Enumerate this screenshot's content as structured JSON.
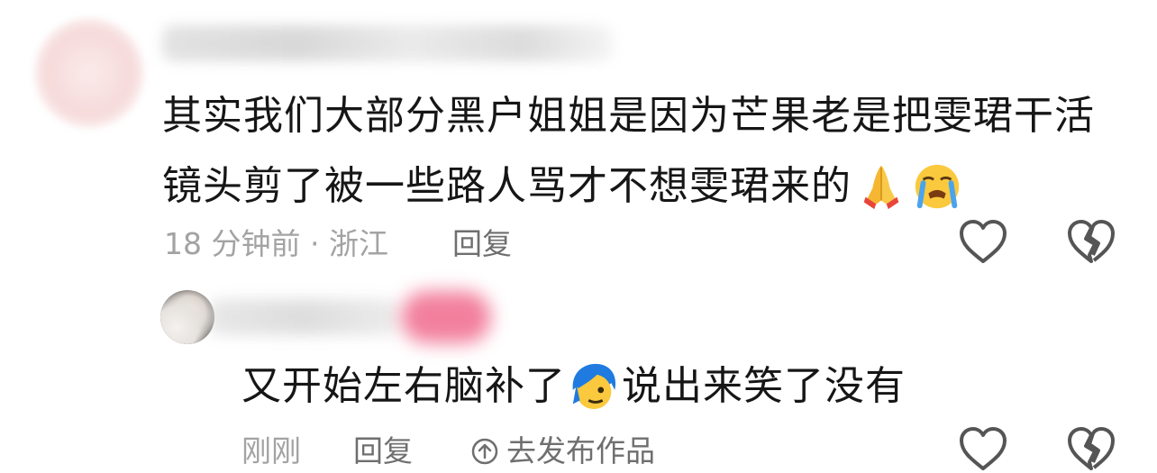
{
  "comments": [
    {
      "text_line1": "其实我们大部分黑户姐姐是因为芒果老是把雯珺干活",
      "text_line2": "镜头剪了被一些路人骂才不想雯珺来的",
      "emojis": [
        "folded-hands-emoji",
        "crying-face-emoji"
      ],
      "meta": "18 分钟前 · 浙江",
      "reply_label": "回复"
    },
    {
      "text_part1": "又开始左右脑补了",
      "text_part2": "说出来笑了没有",
      "emojis": [
        "blue-hair-emoji"
      ],
      "meta": "刚刚",
      "reply_label": "回复",
      "publish_label": "去发布作品"
    }
  ],
  "icons": {
    "like": "heart-outline-icon",
    "dislike": "broken-heart-icon",
    "publish": "arrow-up-circle-icon"
  },
  "colors": {
    "text": "#161616",
    "meta": "#a3a3a3",
    "reply": "#6f6f6f",
    "icon": "#555555"
  }
}
